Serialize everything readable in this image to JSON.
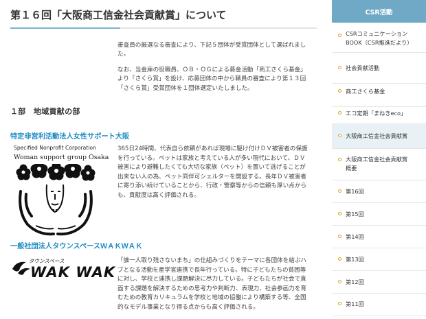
{
  "page": {
    "title": "第１６回「大阪商工信金社会貢献賞」について"
  },
  "intro": {
    "paragraph1": [
      "審査員の厳選なる審査により、下記５団体が受賞団体として選ばれまし",
      "た。"
    ],
    "paragraph2": [
      "なお、当金庫の役職員、ＯＢ・ＯＧによる募金活動「商工さくら基金」",
      "より「さくら賞」を設け、応募団体の中から職員の審査により第１３回",
      "「さくら賞」受賞団体を１団体選定いたしました。"
    ]
  },
  "section": {
    "heading": "１部　地域貢献の部"
  },
  "org1": {
    "name": "特定非営利活動法人女性サポート大阪",
    "logo_line1": "Specified Nonprofit Corporation",
    "logo_line2": "Woman support group Osaka",
    "body": [
      "365日24時間、代表自ら依頼があれば現場に駆け付けＤＶ被害者の保護",
      "を行っている。ペットは家族と考えている人が多い現代において、ＤＶ",
      "被害により避難したくても大切な家族（ペット）を置いて逃げることが",
      "出来ない人の為、ペット同伴可シェルターを開設する。長年ＤＶ被害者",
      "に寄り添い続けていることから、行政・警察等からの信頼も厚い点から",
      "も、貢献度は高く評価される。"
    ]
  },
  "org2": {
    "name": "一般社団法人タウンスペースＷＡＫＷＡＫ",
    "logo_small": "タウンスペース",
    "logo_big": "WAK WAK",
    "body": [
      "「誰一人取り残さないまち」の仕組みづくりをテーマに各団体を結ぶハ",
      "ブとなる活動を産学官連携で長年行っている。特に子どもたちの貧困等",
      "に対し、学校と連携し課題解決に尽力している。子どもたちが社会で直",
      "面する課題を解決するための思考力や判断力、表現力、社会参画力を育",
      "むための教育カリキュラムを学校と地域の協働により構築する等、全国",
      "的なモデル事業となり得る点からも高く評価される。"
    ]
  },
  "sidebar": {
    "header": "CSR活動",
    "items": [
      {
        "label_lines": [
          "CSRコミュニケーション",
          "BOOK（CSR推進だより）"
        ],
        "active": false
      },
      {
        "label_lines": [
          "社会貢献活動"
        ],
        "active": false
      },
      {
        "label_lines": [
          "商工さくら基金"
        ],
        "active": false
      },
      {
        "label_lines": [
          "エコ定期「まねきeco」"
        ],
        "active": false
      },
      {
        "label_lines": [
          "大阪商工信金社会貢献賞"
        ],
        "active": true
      },
      {
        "label_lines": [
          "大阪商工信金社会貢献賞",
          "概要"
        ],
        "active": false
      },
      {
        "label_lines": [
          "第16回"
        ],
        "active": false
      },
      {
        "label_lines": [
          "第15回"
        ],
        "active": false
      },
      {
        "label_lines": [
          "第14回"
        ],
        "active": false
      },
      {
        "label_lines": [
          "第13回"
        ],
        "active": false
      },
      {
        "label_lines": [
          "第12回"
        ],
        "active": false
      },
      {
        "label_lines": [
          "第11回"
        ],
        "active": false
      }
    ]
  },
  "colors": {
    "accent_blue": "#1a8ac2",
    "sidebar_header": "#6fa9c6",
    "bullet_gold": "#d5a81e",
    "active_bg": "#e8f2f6"
  }
}
